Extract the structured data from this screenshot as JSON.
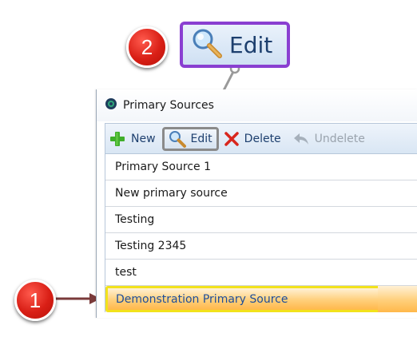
{
  "callouts": {
    "step1": "1",
    "step2": "2",
    "zoom_label": "Edit",
    "badge_color": "#d91f16",
    "zoom_border_color": "#8a3fd1",
    "highlight_border_color": "#f2e21c"
  },
  "window": {
    "title": "Primary Sources",
    "title_icon": "app-circle-icon"
  },
  "toolbar": {
    "new_label": "New",
    "edit_label": "Edit",
    "delete_label": "Delete",
    "undelete_label": "Undelete"
  },
  "list": {
    "rows": [
      "Primary Source 1",
      "New primary source",
      "Testing",
      "Testing 2345",
      "test",
      "Demonstration Primary Source"
    ],
    "selected_index": 5
  }
}
